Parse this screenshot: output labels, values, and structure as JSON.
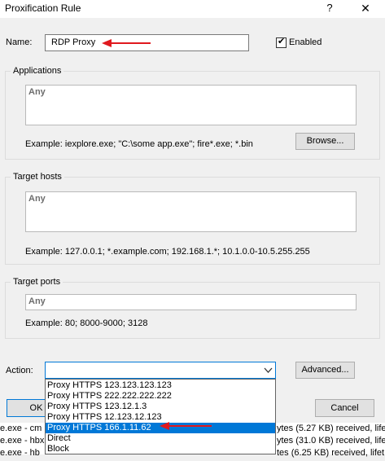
{
  "window": {
    "title": "Proxification Rule",
    "help_label": "?",
    "close_label": "✕"
  },
  "name": {
    "label": "Name:",
    "value": "RDP Proxy",
    "enabled_label": "Enabled",
    "enabled_checked": true
  },
  "applications": {
    "title": "Applications",
    "value": "Any",
    "example": "Example: iexplore.exe; \"C:\\some app.exe\"; fire*.exe; *.bin",
    "browse_label": "Browse..."
  },
  "target_hosts": {
    "title": "Target hosts",
    "value": "Any",
    "example": "Example: 127.0.0.1; *.example.com; 192.168.1.*; 10.1.0.0-10.5.255.255"
  },
  "target_ports": {
    "title": "Target ports",
    "value": "Any",
    "example": "Example: 80; 8000-9000; 3128"
  },
  "action": {
    "label": "Action:",
    "advanced_label": "Advanced...",
    "dropdown_icon": "chevron-down-icon",
    "options": [
      "Proxy HTTPS 123.123.123.123",
      "Proxy HTTPS 222.222.222.222",
      "Proxy HTTPS 123.12.1.3",
      "Proxy HTTPS 12.123.12.123",
      "Proxy HTTPS 166.1.11.62",
      "Direct",
      "Block"
    ],
    "highlighted_index": 4
  },
  "buttons": {
    "ok_label": "OK",
    "cancel_label": "Cancel"
  },
  "background_log": {
    "lines": [
      {
        "left": "e.exe - cm",
        "right": "ytes (5.27 KB) received, life"
      },
      {
        "left": "e.exe - hbx",
        "right": "ytes (31.0 KB) received, lifet"
      },
      {
        "left": "e.exe - hb",
        "right": "tes (6.25 KB) received, lifet"
      }
    ]
  },
  "colors": {
    "annotation_arrow": "#e0191e",
    "accent": "#0078d7"
  }
}
